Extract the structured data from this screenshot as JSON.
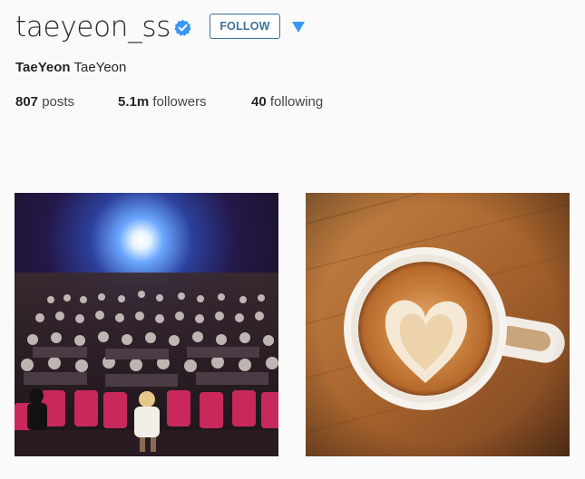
{
  "profile": {
    "username": "taeyeon_ss",
    "verified_icon": "verified-badge-icon",
    "follow_label": "FOLLOW",
    "dropdown_icon": "caret-down-icon",
    "full_name_bold": "TaeYeon",
    "full_name_rest": "TaeYeon"
  },
  "stats": {
    "posts_count": "807",
    "posts_label": "posts",
    "followers_count": "5.1m",
    "followers_label": "followers",
    "following_count": "40",
    "following_label": "following"
  },
  "photos": [
    {
      "icon": "photo-theater-audience"
    },
    {
      "icon": "photo-latte-heart"
    }
  ],
  "colors": {
    "accent": "#3f729b",
    "verified": "#3897f0",
    "caret": "#3897f0",
    "background": "#fafafa"
  }
}
